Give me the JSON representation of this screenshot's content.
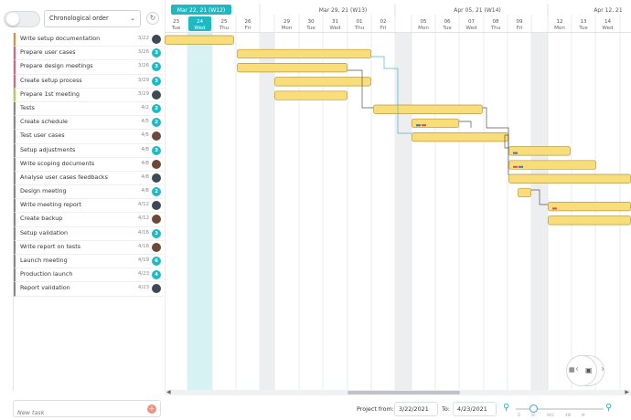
{
  "toolbar": {
    "sort_value": "Chronological order"
  },
  "tasks": [
    {
      "name": "Write setup documentation",
      "date": "3/22",
      "color": "#f08a35",
      "avatar": "photo"
    },
    {
      "name": "Prepare user cases",
      "date": "3/26",
      "color": "#e0607e",
      "avatar": "3"
    },
    {
      "name": "Prepare design meetings",
      "date": "3/26",
      "color": "#e0607e",
      "avatar": "3"
    },
    {
      "name": "Create setup process",
      "date": "3/29",
      "color": "#e0607e",
      "avatar": "3"
    },
    {
      "name": "Prepare 1st meeting",
      "date": "3/29",
      "color": "#a6d64b",
      "avatar": "photo"
    },
    {
      "name": "Tests",
      "date": "4/2",
      "color": "#888888",
      "avatar": "2"
    },
    {
      "name": "Create schedule",
      "date": "4/5",
      "color": "#888888",
      "avatar": "2"
    },
    {
      "name": "Test user cases",
      "date": "4/5",
      "color": "#888888",
      "avatar": "photo"
    },
    {
      "name": "Setup adjustments",
      "date": "4/8",
      "color": "#888888",
      "avatar": "3"
    },
    {
      "name": "Write scoping documents",
      "date": "4/8",
      "color": "#888888",
      "avatar": "photo"
    },
    {
      "name": "Analyse user cases feedbacks",
      "date": "4/8",
      "color": "#888888",
      "avatar": "photo"
    },
    {
      "name": "Design meeting",
      "date": "4/8",
      "color": "#888888",
      "avatar": "2"
    },
    {
      "name": "Write meeting report",
      "date": "4/12",
      "color": "#888888",
      "avatar": "photo"
    },
    {
      "name": "Create backup",
      "date": "4/12",
      "color": "#888888",
      "avatar": "photo"
    },
    {
      "name": "Setup validation",
      "date": "4/16",
      "color": "#888888",
      "avatar": "3"
    },
    {
      "name": "Write report on tests",
      "date": "4/16",
      "color": "#888888",
      "avatar": "photo"
    },
    {
      "name": "Launch meeting",
      "date": "4/19",
      "color": "#888888",
      "avatar": "6"
    },
    {
      "name": "Production launch",
      "date": "4/23",
      "color": "#888888",
      "avatar": "4"
    },
    {
      "name": "Report validation",
      "date": "4/23",
      "color": "#888888",
      "avatar": "photo"
    }
  ],
  "new_task": {
    "placeholder": "New task",
    "add_symbol": "+"
  },
  "timeline": {
    "weeks": [
      {
        "label": "Mar 22, 21 (W12)",
        "highlight": true
      },
      {
        "label": "Mar 29, 21 (W13)",
        "highlight": false
      },
      {
        "label": "Apr 05, 21 (W14)",
        "highlight": false
      },
      {
        "label": "Apr 12, 21",
        "highlight": false
      }
    ],
    "days": [
      {
        "num": "23",
        "dow": "Tue"
      },
      {
        "num": "24",
        "dow": "Wed",
        "today": true
      },
      {
        "num": "25",
        "dow": "Thu"
      },
      {
        "num": "26",
        "dow": "Fri"
      },
      {
        "num": "",
        "dow": "",
        "weekend": true
      },
      {
        "num": "29",
        "dow": "Mon"
      },
      {
        "num": "30",
        "dow": "Tue"
      },
      {
        "num": "31",
        "dow": "Wed"
      },
      {
        "num": "01",
        "dow": "Thu"
      },
      {
        "num": "02",
        "dow": "Fri"
      },
      {
        "num": "",
        "dow": "",
        "weekend": true
      },
      {
        "num": "05",
        "dow": "Mon"
      },
      {
        "num": "06",
        "dow": "Tue"
      },
      {
        "num": "07",
        "dow": "Wed"
      },
      {
        "num": "08",
        "dow": "Thu"
      },
      {
        "num": "09",
        "dow": "Fri"
      },
      {
        "num": "",
        "dow": "",
        "weekend": true
      },
      {
        "num": "12",
        "dow": "Mon"
      },
      {
        "num": "13",
        "dow": "Tue"
      },
      {
        "num": "14",
        "dow": "Wed"
      }
    ]
  },
  "footer": {
    "project_from_label": "Project from:",
    "project_from": "3/22/2021",
    "to_label": "To:",
    "project_to": "4/23/2021",
    "zoom_levels": [
      "D",
      "W",
      "W/2",
      "4W",
      "M"
    ]
  },
  "colors": {
    "accent": "#1fb9c3",
    "bar_fill": "#f8dd7a",
    "bar_stroke": "#b79b3a",
    "today_column": "#d6f2f3",
    "weekend": "#eceef0"
  }
}
